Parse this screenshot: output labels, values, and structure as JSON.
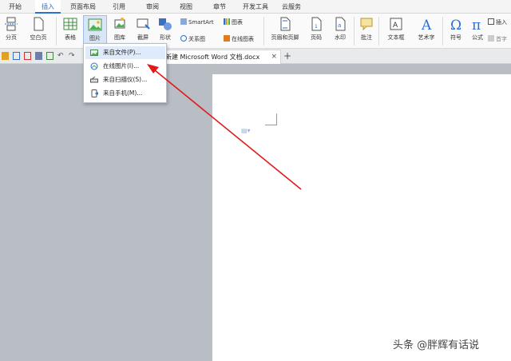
{
  "menu_tabs": [
    "开始",
    "插入",
    "页面布局",
    "引用",
    "审阅",
    "视图",
    "章节",
    "开发工具",
    "云服务"
  ],
  "active_tab": "插入",
  "ribbon": {
    "page_break": "分页",
    "blank_page": "空白页",
    "table": "表格",
    "picture": "图片",
    "gallery": "图库",
    "screenshot": "截屏",
    "shapes": "形状",
    "smartart": "SmartArt",
    "chart": "图表",
    "relation_chart": "关系图",
    "online_chart": "在线图表",
    "header_footer": "页眉和页脚",
    "page_number": "页码",
    "watermark": "水印",
    "comment": "批注",
    "textbox": "文本框",
    "wordart": "艺术字",
    "symbol": "符号",
    "formula": "公式",
    "insert_more": "插入",
    "more_small": "首字"
  },
  "document_tab": {
    "title": "新建 Microsoft Word 文档.docx",
    "close": "×",
    "new_tab": "+"
  },
  "dropdown": {
    "items": [
      "来自文件(P)...",
      "在线图片(I)...",
      "来自扫描仪(S)...",
      "来自手机(M)..."
    ]
  },
  "watermark_text": "头条 @胖辉有话说",
  "colors": {
    "accent": "#2a6fd6",
    "arrow": "#e0191b",
    "background": "#b9bdc4"
  }
}
